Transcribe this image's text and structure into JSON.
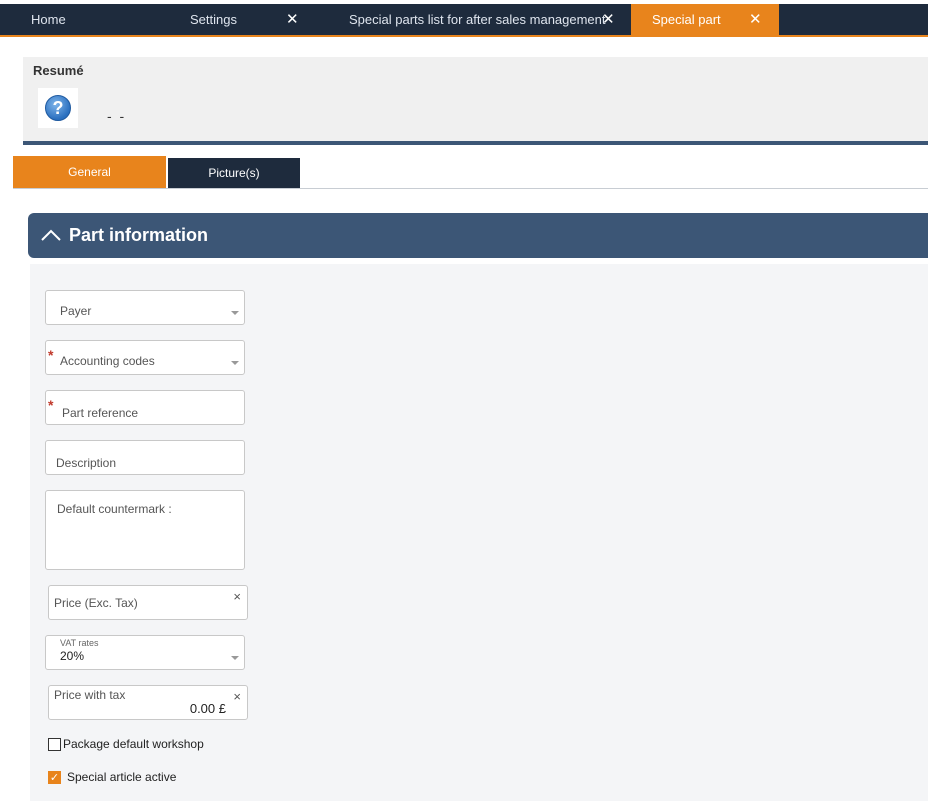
{
  "top_tabs": [
    {
      "label": "Home"
    },
    {
      "label": "Settings",
      "close": "✕"
    },
    {
      "label": "Special parts list for after sales management",
      "close": "✕"
    },
    {
      "label": "Special part",
      "close": "✕"
    }
  ],
  "resume": {
    "title": "Resumé",
    "help_glyph": "?",
    "summary": "- -"
  },
  "section_tabs": {
    "general": "General",
    "pictures": "Picture(s)"
  },
  "panel": {
    "title": "Part information"
  },
  "form": {
    "payer": {
      "label": "Payer"
    },
    "accounting_codes": {
      "label": "Accounting codes",
      "required_mark": "*"
    },
    "part_reference": {
      "label": "Part reference",
      "required_mark": "*"
    },
    "description": {
      "label": "Description"
    },
    "default_countermark": {
      "label": "Default countermark :"
    },
    "price_excl_tax": {
      "label": "Price (Exc. Tax)",
      "clear": "×"
    },
    "vat_rates": {
      "label": "VAT rates",
      "value": "20%"
    },
    "price_with_tax": {
      "label": "Price with tax",
      "value": "0.00 £",
      "clear": "×"
    },
    "package_default_workshop": {
      "label": "Package default workshop",
      "checked": false
    },
    "special_article_active": {
      "label": "Special article active",
      "checked": true,
      "check_glyph": "✓"
    }
  },
  "colors": {
    "accent": "#e8841c",
    "nav_dark": "#1e2b3d",
    "panel_header": "#3c5676"
  }
}
